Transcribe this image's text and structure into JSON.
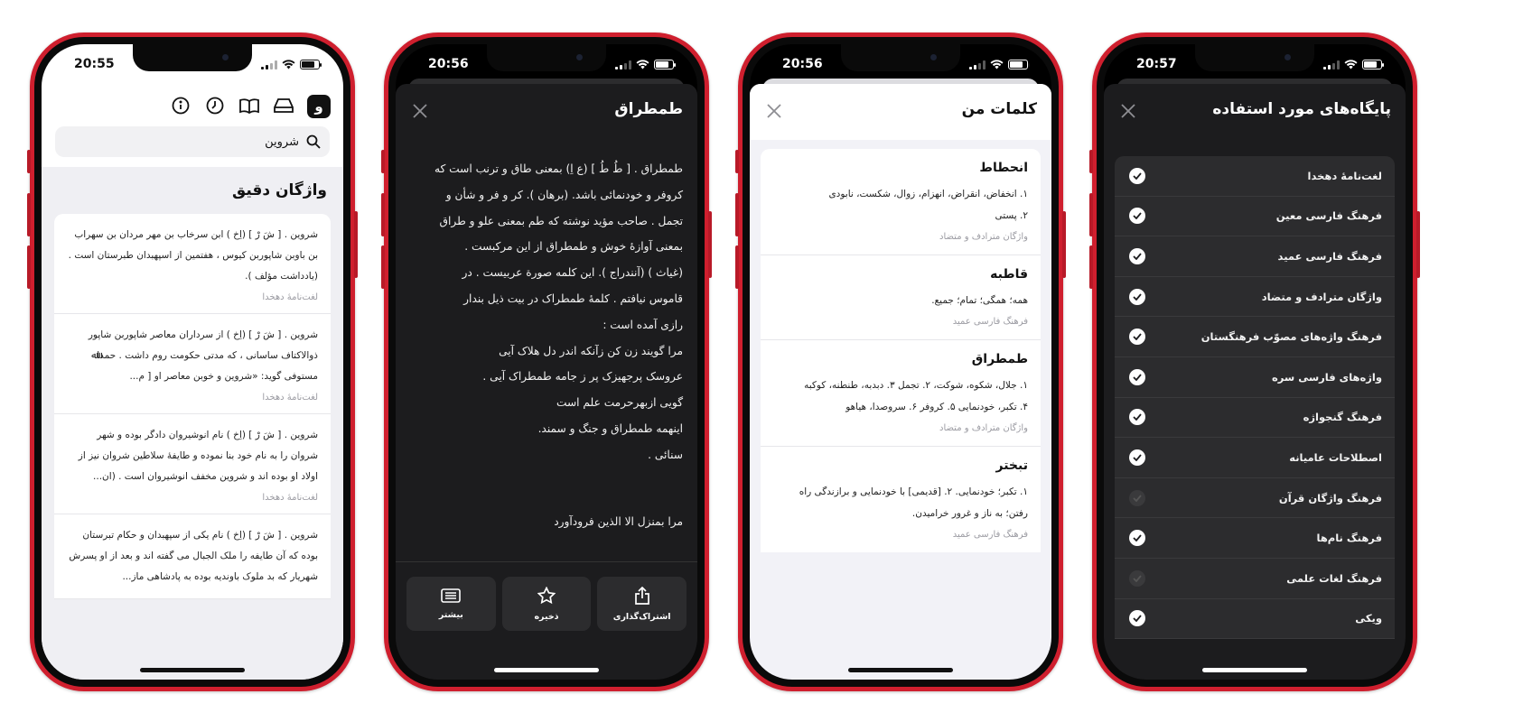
{
  "phone1": {
    "time": "20:55",
    "toolbar_logo": "و",
    "toolbar_icons": [
      "app-logo-icon",
      "drawer-icon",
      "book-icon",
      "history-icon",
      "info-icon"
    ],
    "search_value": "شروین",
    "section_title": "واژگان دقیق",
    "results": [
      {
        "text": "شروین . [ شَ رْ ] (اِخ ) ابن سرخاب بن مهر مردان بن سهراب بن باوبن شاپوربن کیوس ، هفتمین از اسپهبدان طبرستان است . (یادداشت مؤلف ).",
        "source": "لغت‌نامهٔ دهخدا"
      },
      {
        "text": "شروین . [ شَ رْ ] (اِخ ) از سرداران معاصر شاپوربن شاپور ذوالاکتاف ساسانی ، که مدتی حکومت روم داشت . حمداﷲ مستوفی گوید: «شروین و خوبن معاصر او [ م...",
        "source": "لغت‌نامهٔ دهخدا"
      },
      {
        "text": "شروین . [ شَ رْ ] (اِخ ) نام انوشیروان دادگر بوده و شهر شروان را به نام خود بنا نموده و طایفهٔ سلاطین شروان نیز از اولاد او بوده اند و شروین مخفف انوشیروان است . (ان...",
        "source": "لغت‌نامهٔ دهخدا"
      },
      {
        "text": "شروین . [ شَ رْ ] (اِخ ) نام یکی از سپهبدان و حکام تبرستان بوده که آن طایفه را ملک الجبال می گفته اند و بعد از او پسرش شهریار که بد ملوک باوندیه بوده به پادشاهی ماز...",
        "source": ""
      }
    ]
  },
  "phone2": {
    "time": "20:56",
    "title": "طمطراق",
    "definition": [
      "طمطراق . [ طُ طُ ] (ع اِ) بمعنی طاق و ترنب است که",
      "کروفر و خودنمائی باشد. (برهان ). کر و فر و شأن و",
      "تجمل . صاحب مؤید نوشته که طم بمعنی علو و طراق",
      "بمعنی آوازهٔ خوش و طمطراق از این مرکبست .",
      "(غیاث ) (آنندراج ). این کلمه صورة عربیست . در",
      "قاموس نیافتم . کلمهٔ طمطراک در بیت ذیل بندار",
      "رازی آمده است :",
      "مرا گویند زن کن زآنکه اندر دل هلاک آیی",
      "عروسک پرجهیزک پر ز جامه طمطراک آیی .",
      "گویی ازبهرحرمت علم است",
      "اینهمه طمطراق و جنگ و سمند.",
      "سنائی ."
    ],
    "definition_more": "مرا بمنزل الا الذین فرودآورد",
    "actions": [
      {
        "label": "اشتراک‌گذاری",
        "icon": "share-icon"
      },
      {
        "label": "ذخیره",
        "icon": "star-icon"
      },
      {
        "label": "بیشتر",
        "icon": "more-icon"
      }
    ]
  },
  "phone3": {
    "time": "20:56",
    "title": "کلمات من",
    "words": [
      {
        "word": "انحطاط",
        "lines": [
          "۱. انخفاض، انقراض، انهزام، زوال، شکست، نابودی",
          "۲. پستی"
        ],
        "source": "واژگان مترادف و متضاد"
      },
      {
        "word": "قاطبه",
        "lines": [
          "همه؛ همگی؛ تمام؛ جمیع."
        ],
        "source": "فرهنگ فارسی عمید"
      },
      {
        "word": "طمطراق",
        "lines": [
          "۱. جلال، شکوه، شوکت، ۲. تجمل ۳. دبدبه، طنطنه، کوکبه",
          "۴. تکبر، خودنمایی ۵. کروفر ۶. سروصدا، هیاهو"
        ],
        "source": "واژگان مترادف و متضاد"
      },
      {
        "word": "تبختر",
        "lines": [
          "۱. تکبر؛ خودنمایی. ۲. [قدیمی] با خودنمایی و برازندگی راه",
          "رفتن؛ به ناز و غرور خرامیدن."
        ],
        "source": "فرهنگ فارسی عمید"
      }
    ]
  },
  "phone4": {
    "time": "20:57",
    "title": "پایگاه‌های مورد استفاده",
    "sources": [
      {
        "label": "لغت‌نامهٔ دهخدا",
        "checked": true
      },
      {
        "label": "فرهنگ فارسی معین",
        "checked": true
      },
      {
        "label": "فرهنگ فارسی عمید",
        "checked": true
      },
      {
        "label": "واژگان مترادف و متضاد",
        "checked": true
      },
      {
        "label": "فرهنگ واژه‌های مصوّب فرهنگستان",
        "checked": true
      },
      {
        "label": "واژه‌های فارسی سره",
        "checked": true
      },
      {
        "label": "فرهنگ گنجواژه",
        "checked": true
      },
      {
        "label": "اصطلاحات عامیانه",
        "checked": true
      },
      {
        "label": "فرهنگ واژگان قرآن",
        "checked": false
      },
      {
        "label": "فرهنگ نام‌ها",
        "checked": true
      },
      {
        "label": "فرهنگ لغات علمی",
        "checked": false
      },
      {
        "label": "ویکی",
        "checked": true
      }
    ]
  }
}
